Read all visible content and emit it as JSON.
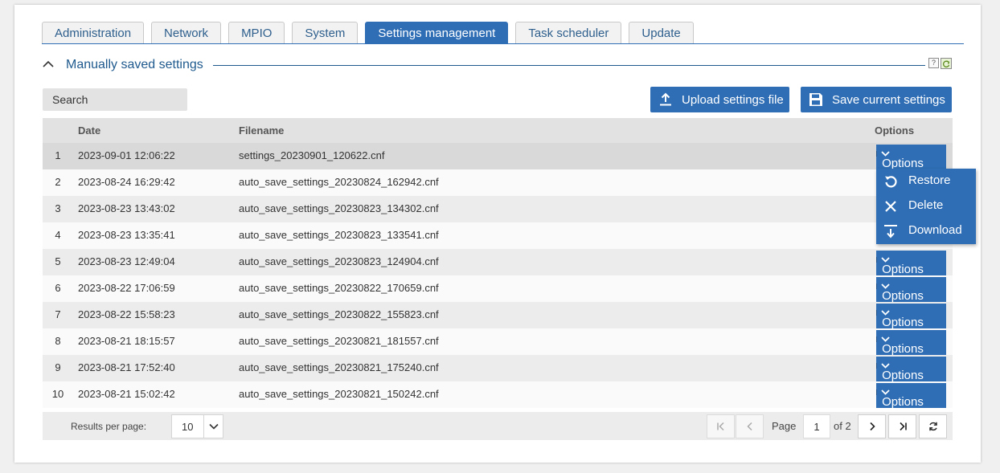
{
  "tabs": [
    "Administration",
    "Network",
    "MPIO",
    "System",
    "Settings management",
    "Task scheduler",
    "Update"
  ],
  "active_tab": "Settings management",
  "section": {
    "title": "Manually saved settings",
    "help": "?"
  },
  "search": {
    "placeholder": "Search"
  },
  "buttons": {
    "upload": "Upload settings file",
    "save": "Save current settings"
  },
  "table": {
    "columns": {
      "date": "Date",
      "filename": "Filename",
      "options": "Options"
    },
    "rows": [
      {
        "num": "1",
        "date": "2023-09-01 12:06:22",
        "filename": "settings_20230901_120622.cnf"
      },
      {
        "num": "2",
        "date": "2023-08-24 16:29:42",
        "filename": "auto_save_settings_20230824_162942.cnf"
      },
      {
        "num": "3",
        "date": "2023-08-23 13:43:02",
        "filename": "auto_save_settings_20230823_134302.cnf"
      },
      {
        "num": "4",
        "date": "2023-08-23 13:35:41",
        "filename": "auto_save_settings_20230823_133541.cnf"
      },
      {
        "num": "5",
        "date": "2023-08-23 12:49:04",
        "filename": "auto_save_settings_20230823_124904.cnf"
      },
      {
        "num": "6",
        "date": "2023-08-22 17:06:59",
        "filename": "auto_save_settings_20230822_170659.cnf"
      },
      {
        "num": "7",
        "date": "2023-08-22 15:58:23",
        "filename": "auto_save_settings_20230822_155823.cnf"
      },
      {
        "num": "8",
        "date": "2023-08-21 18:15:57",
        "filename": "auto_save_settings_20230821_181557.cnf"
      },
      {
        "num": "9",
        "date": "2023-08-21 17:52:40",
        "filename": "auto_save_settings_20230821_175240.cnf"
      },
      {
        "num": "10",
        "date": "2023-08-21 15:02:42",
        "filename": "auto_save_settings_20230821_150242.cnf"
      }
    ],
    "options_label": "Options",
    "selected_row": 1
  },
  "options_menu": {
    "items": [
      "Restore",
      "Delete",
      "Download"
    ],
    "open_for_row": 1
  },
  "pagination": {
    "results_per_page_label": "Results per page:",
    "results_per_page": "10",
    "page_label": "Page",
    "current_page": "1",
    "of_label": "of 2"
  },
  "colors": {
    "accent": "#2f6eb5",
    "title": "#1f5a8e"
  }
}
